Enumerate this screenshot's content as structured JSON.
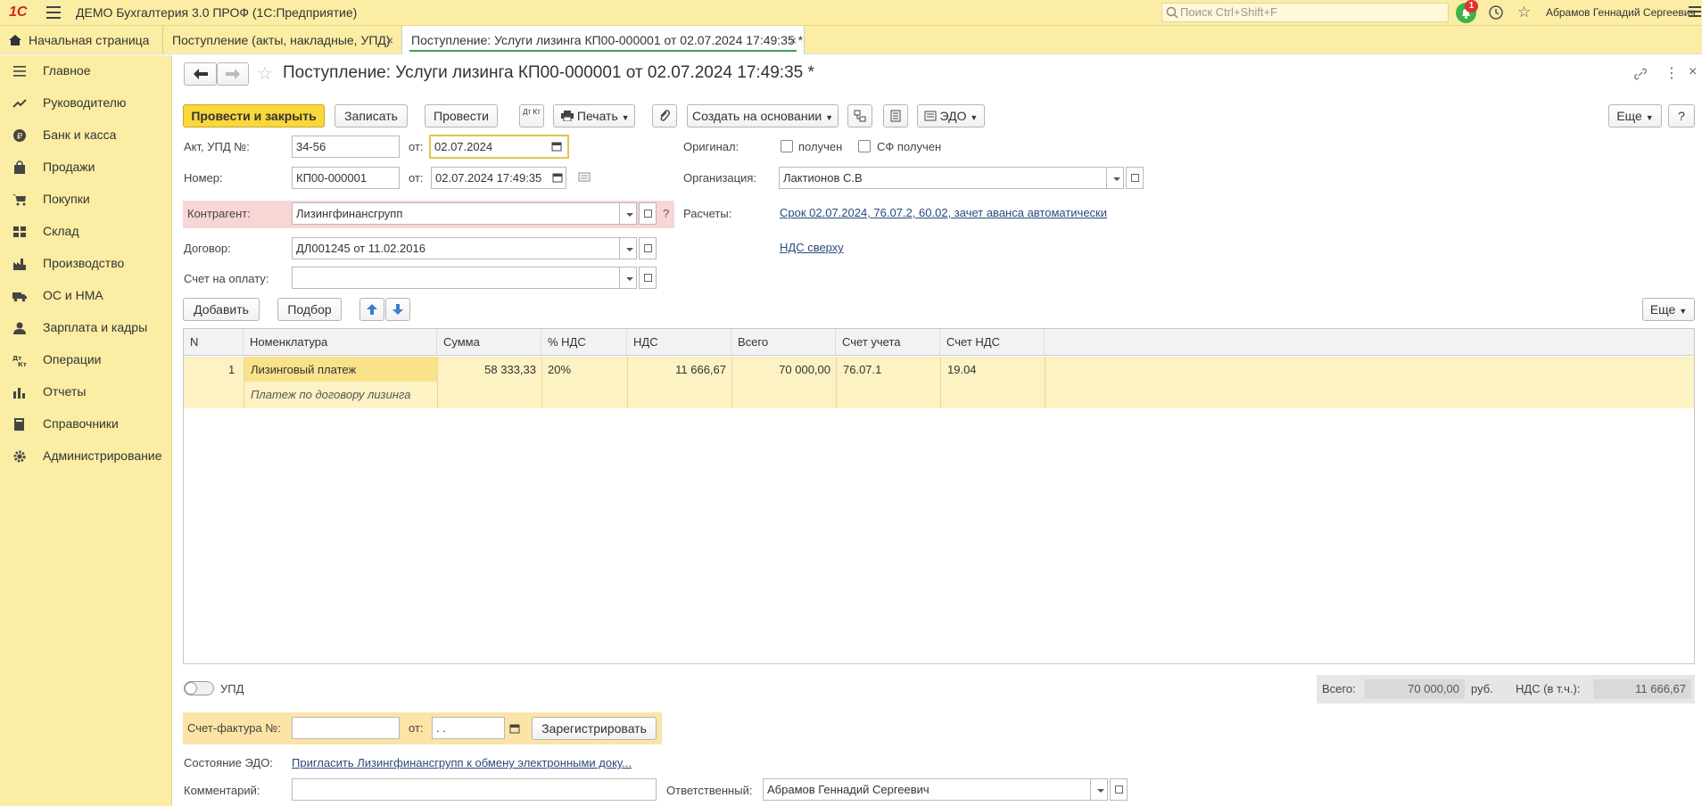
{
  "app": {
    "title": "ДЕМО Бухгалтерия 3.0 ПРОФ  (1С:Предприятие)",
    "search_placeholder": "Поиск Ctrl+Shift+F",
    "notifications_count": "1",
    "user": "Абрамов Геннадий Сергеевич",
    "logo": "1С"
  },
  "tabs": [
    {
      "label": "Начальная страница"
    },
    {
      "label": "Поступление (акты, накладные, УПД)"
    },
    {
      "label": "Поступление: Услуги лизинга КП00-000001 от 02.07.2024 17:49:35 *"
    }
  ],
  "sidebar": {
    "items": [
      {
        "label": "Главное",
        "icon": "list-icon"
      },
      {
        "label": "Руководителю",
        "icon": "trend-icon"
      },
      {
        "label": "Банк и касса",
        "icon": "ruble-icon"
      },
      {
        "label": "Продажи",
        "icon": "bag-icon"
      },
      {
        "label": "Покупки",
        "icon": "cart-icon"
      },
      {
        "label": "Склад",
        "icon": "warehouse-icon"
      },
      {
        "label": "Производство",
        "icon": "factory-icon"
      },
      {
        "label": "ОС и НМА",
        "icon": "truck-icon"
      },
      {
        "label": "Зарплата и кадры",
        "icon": "person-icon"
      },
      {
        "label": "Операции",
        "icon": "operations-icon"
      },
      {
        "label": "Отчеты",
        "icon": "chart-icon"
      },
      {
        "label": "Справочники",
        "icon": "book-icon"
      },
      {
        "label": "Администрирование",
        "icon": "gear-icon"
      }
    ]
  },
  "doc": {
    "title": "Поступление: Услуги лизинга КП00-000001 от 02.07.2024 17:49:35 *",
    "toolbar": {
      "post_close": "Провести и закрыть",
      "save": "Записать",
      "post": "Провести",
      "dtkt": "Дт Кт",
      "print": "Печать",
      "create_based": "Создать на основании",
      "edo": "ЭДО",
      "more": "Еще",
      "help": "?"
    },
    "fields": {
      "act_label": "Акт, УПД №:",
      "act_value": "34-56",
      "from_label": "от:",
      "act_date": "02.07.2024",
      "number_label": "Номер:",
      "number_value": "КП00-000001",
      "number_date": "02.07.2024 17:49:35",
      "contractor_label": "Контрагент:",
      "contractor_value": "Лизингфинансгрупп",
      "contract_label": "Договор:",
      "contract_value": "ДЛ001245 от 11.02.2016",
      "invoice_label": "Счет на оплату:",
      "invoice_value": "",
      "original_label": "Оригинал:",
      "received_label": "получен",
      "sf_received_label": "СФ получен",
      "org_label": "Организация:",
      "org_value": "Лактионов С.В",
      "calc_label": "Расчеты:",
      "calc_link": "Срок 02.07.2024, 76.07.2, 60.02, зачет аванса автоматически",
      "vat_link": "НДС сверху",
      "question": "?"
    },
    "table_toolbar": {
      "add": "Добавить",
      "pick": "Подбор",
      "more": "Еще"
    },
    "table": {
      "columns": [
        "N",
        "Номенклатура",
        "Сумма",
        "% НДС",
        "НДС",
        "Всего",
        "Счет учета",
        "Счет НДС"
      ],
      "rows": [
        {
          "n": "1",
          "item": "Лизинговый платеж",
          "item_desc": "Платеж по договору лизинга",
          "sum": "58 333,33",
          "vat_rate": "20%",
          "vat": "11 666,67",
          "total": "70 000,00",
          "account": "76.07.1",
          "vat_account": "19.04"
        }
      ]
    },
    "upd_label": "УПД",
    "totals": {
      "total_label": "Всего:",
      "total_value": "70 000,00",
      "currency": "руб.",
      "vat_label": "НДС (в т.ч.):",
      "vat_value": "11 666,67"
    },
    "sf": {
      "label": "Счет-фактура №:",
      "value": "",
      "from_label": "от:",
      "date_placeholder": " .  .",
      "register": "Зарегистрировать"
    },
    "edo_state_label": "Состояние ЭДО:",
    "edo_state_link": "Пригласить Лизингфинансгрупп к обмену электронными доку...",
    "comment_label": "Комментарий:",
    "comment_value": "",
    "responsible_label": "Ответственный:",
    "responsible_value": "Абрамов Геннадий Сергеевич"
  }
}
